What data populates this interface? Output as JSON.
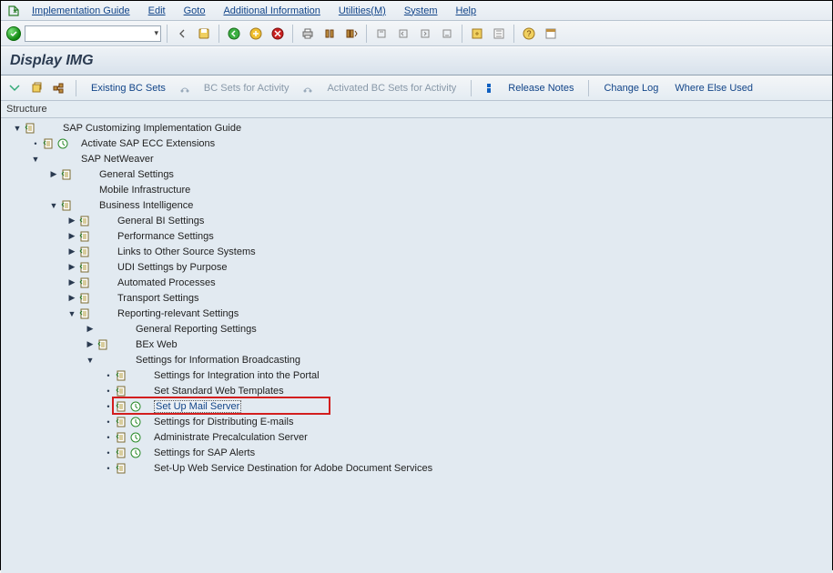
{
  "menu": {
    "items": [
      "Implementation Guide",
      "Edit",
      "Goto",
      "Additional Information",
      "Utilities(M)",
      "System",
      "Help"
    ]
  },
  "title": "Display IMG",
  "subtoolbar": {
    "existing": "Existing BC Sets",
    "bcsets": "BC Sets for Activity",
    "activated": "Activated BC Sets for Activity",
    "release": "Release Notes",
    "changelog": "Change Log",
    "whereelse": "Where Else Used"
  },
  "structure_label": "Structure",
  "tree": [
    {
      "depth": 0,
      "toggle": "down",
      "doc": true,
      "clock": false,
      "label": "SAP Customizing Implementation Guide"
    },
    {
      "depth": 1,
      "toggle": "dot",
      "doc": true,
      "clock": true,
      "label": "Activate SAP ECC Extensions"
    },
    {
      "depth": 1,
      "toggle": "down",
      "doc": false,
      "clock": false,
      "label": "SAP NetWeaver"
    },
    {
      "depth": 2,
      "toggle": "right",
      "doc": true,
      "clock": false,
      "label": "General Settings"
    },
    {
      "depth": 2,
      "toggle": "none",
      "doc": false,
      "clock": false,
      "label": "Mobile Infrastructure"
    },
    {
      "depth": 2,
      "toggle": "down",
      "doc": true,
      "clock": false,
      "label": "Business Intelligence"
    },
    {
      "depth": 3,
      "toggle": "right",
      "doc": true,
      "clock": false,
      "label": "General BI Settings"
    },
    {
      "depth": 3,
      "toggle": "right",
      "doc": true,
      "clock": false,
      "label": "Performance Settings"
    },
    {
      "depth": 3,
      "toggle": "right",
      "doc": true,
      "clock": false,
      "label": "Links to Other Source Systems"
    },
    {
      "depth": 3,
      "toggle": "right",
      "doc": true,
      "clock": false,
      "label": "UDI Settings by Purpose"
    },
    {
      "depth": 3,
      "toggle": "right",
      "doc": true,
      "clock": false,
      "label": "Automated Processes"
    },
    {
      "depth": 3,
      "toggle": "right",
      "doc": true,
      "clock": false,
      "label": "Transport Settings"
    },
    {
      "depth": 3,
      "toggle": "down",
      "doc": true,
      "clock": false,
      "label": "Reporting-relevant Settings"
    },
    {
      "depth": 4,
      "toggle": "right",
      "doc": false,
      "clock": false,
      "label": "General Reporting Settings"
    },
    {
      "depth": 4,
      "toggle": "right",
      "doc": true,
      "clock": false,
      "label": "BEx Web"
    },
    {
      "depth": 4,
      "toggle": "down",
      "doc": false,
      "clock": false,
      "label": "Settings for Information Broadcasting"
    },
    {
      "depth": 5,
      "toggle": "dot",
      "doc": true,
      "clock": false,
      "label": "Settings for Integration into the Portal"
    },
    {
      "depth": 5,
      "toggle": "dot",
      "doc": true,
      "clock": false,
      "label": "Set Standard Web Templates"
    },
    {
      "depth": 5,
      "toggle": "dot",
      "doc": true,
      "clock": true,
      "label": "Set Up Mail Server",
      "highlight": true,
      "selected": true
    },
    {
      "depth": 5,
      "toggle": "dot",
      "doc": true,
      "clock": true,
      "label": "Settings for Distributing E-mails"
    },
    {
      "depth": 5,
      "toggle": "dot",
      "doc": true,
      "clock": true,
      "label": "Administrate Precalculation Server"
    },
    {
      "depth": 5,
      "toggle": "dot",
      "doc": true,
      "clock": true,
      "label": "Settings for SAP Alerts"
    },
    {
      "depth": 5,
      "toggle": "dot",
      "doc": true,
      "clock": false,
      "label": "Set-Up Web Service Destination for Adobe Document Services"
    }
  ]
}
